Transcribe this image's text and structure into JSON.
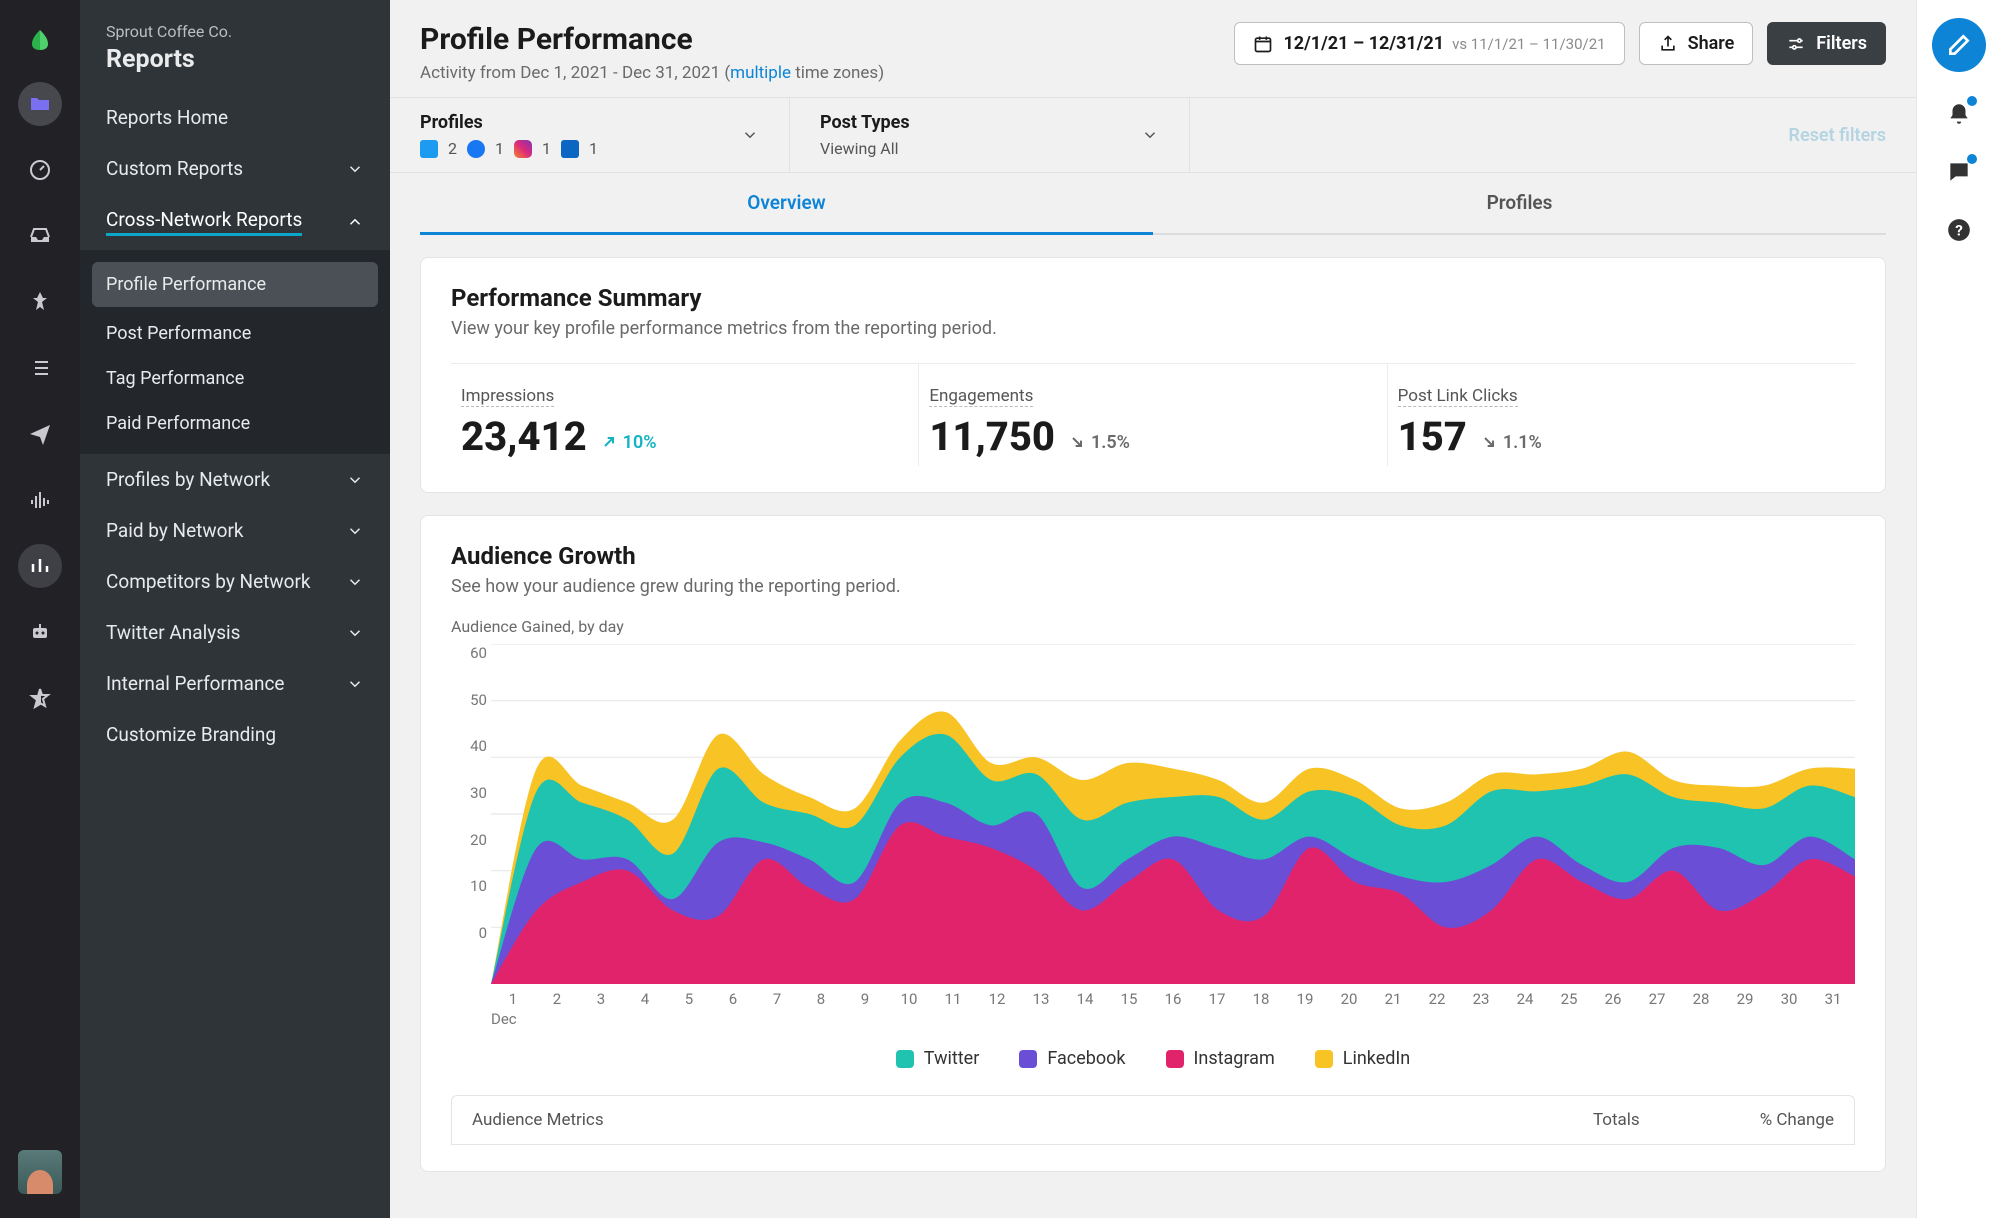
{
  "org": "Sprout Coffee Co.",
  "section": "Reports",
  "sidebar": {
    "items": [
      {
        "label": "Reports Home"
      },
      {
        "label": "Custom Reports",
        "chev": "down"
      },
      {
        "label": "Cross-Network Reports",
        "chev": "up",
        "exp": true
      }
    ],
    "sub": [
      {
        "label": "Profile Performance",
        "sel": true
      },
      {
        "label": "Post Performance"
      },
      {
        "label": "Tag Performance"
      },
      {
        "label": "Paid Performance"
      }
    ],
    "items2": [
      {
        "label": "Profiles by Network",
        "chev": "down"
      },
      {
        "label": "Paid by Network",
        "chev": "down"
      },
      {
        "label": "Competitors by Network",
        "chev": "down"
      },
      {
        "label": "Twitter Analysis",
        "chev": "down"
      },
      {
        "label": "Internal Performance",
        "chev": "down"
      },
      {
        "label": "Customize Branding"
      }
    ]
  },
  "header": {
    "title": "Profile Performance",
    "activity_pre": "Activity from Dec 1, 2021 - Dec 31, 2021 (",
    "activity_link": "multiple",
    "activity_post": " time zones)",
    "date_range": "12/1/21 – 12/31/21",
    "date_vs": "vs 11/1/21 – 11/30/21",
    "share": "Share",
    "filters": "Filters"
  },
  "filterbar": {
    "profiles_label": "Profiles",
    "posttypes_label": "Post Types",
    "posttypes_value": "Viewing All",
    "reset": "Reset filters",
    "counts": {
      "tw": "2",
      "fb": "1",
      "ig": "1",
      "li": "1"
    }
  },
  "tabs": {
    "overview": "Overview",
    "profiles": "Profiles"
  },
  "summary": {
    "title": "Performance Summary",
    "desc": "View your key profile performance metrics from the reporting period.",
    "metrics": [
      {
        "label": "Impressions",
        "value": "23,412",
        "delta": "10%",
        "dir": "up"
      },
      {
        "label": "Engagements",
        "value": "11,750",
        "delta": "1.5%",
        "dir": "down"
      },
      {
        "label": "Post Link Clicks",
        "value": "157",
        "delta": "1.1%",
        "dir": "down"
      }
    ]
  },
  "growth": {
    "title": "Audience Growth",
    "desc": "See how your audience grew during the reporting period.",
    "chart_label": "Audience Gained, by day",
    "xmonth": "Dec"
  },
  "legend": {
    "tw": "Twitter",
    "fb": "Facebook",
    "ig": "Instagram",
    "li": "LinkedIn"
  },
  "colors": {
    "tw": "#1fc3b0",
    "fb": "#6a4fd6",
    "ig": "#e0236b",
    "li": "#f7c325"
  },
  "table": {
    "col1": "Audience Metrics",
    "col2": "Totals",
    "col3": "% Change"
  },
  "chart_data": {
    "type": "area",
    "xlabel": "Dec",
    "ylabel": "",
    "ylim": [
      0,
      60
    ],
    "yticks": [
      0,
      10,
      20,
      30,
      40,
      50,
      60
    ],
    "categories": [
      1,
      2,
      3,
      4,
      5,
      6,
      7,
      8,
      9,
      10,
      11,
      12,
      13,
      14,
      15,
      16,
      17,
      18,
      19,
      20,
      21,
      22,
      23,
      24,
      25,
      26,
      27,
      28,
      29,
      30,
      31
    ],
    "series": [
      {
        "name": "Twitter",
        "color": "#1fc3b0",
        "values": [
          0,
          10,
          10,
          7,
          8,
          13,
          7,
          8,
          10,
          8,
          12,
          8,
          7,
          12,
          10,
          7,
          9,
          7,
          8,
          11,
          9,
          10,
          13,
          8,
          14,
          19,
          9,
          8,
          10,
          9,
          11
        ]
      },
      {
        "name": "Facebook",
        "color": "#6a4fd6",
        "values": [
          0,
          11,
          4,
          2,
          2,
          13,
          3,
          5,
          3,
          4,
          6,
          4,
          10,
          4,
          4,
          4,
          11,
          10,
          2,
          4,
          3,
          8,
          8,
          4,
          3,
          3,
          4,
          11,
          5,
          4,
          3
        ]
      },
      {
        "name": "Instagram",
        "color": "#e0236b",
        "values": [
          0,
          13,
          18,
          20,
          13,
          12,
          22,
          17,
          15,
          28,
          26,
          24,
          20,
          13,
          18,
          22,
          13,
          12,
          24,
          18,
          16,
          10,
          13,
          22,
          18,
          15,
          20,
          13,
          16,
          22,
          19
        ]
      },
      {
        "name": "LinkedIn",
        "color": "#f7c325",
        "values": [
          0,
          4,
          3,
          3,
          6,
          6,
          5,
          3,
          3,
          3,
          4,
          3,
          3,
          7,
          7,
          5,
          3,
          3,
          4,
          3,
          3,
          4,
          3,
          3,
          3,
          4,
          3,
          3,
          4,
          3,
          5
        ]
      }
    ]
  }
}
